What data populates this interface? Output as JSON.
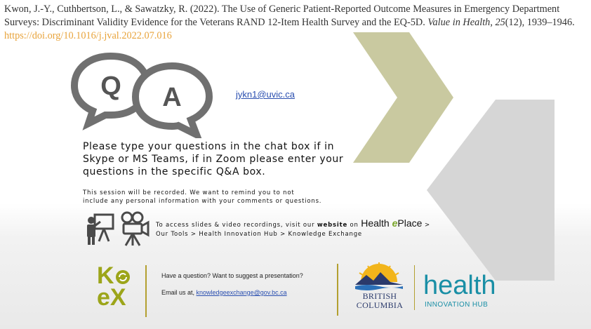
{
  "citation": {
    "text": "Kwon, J.-Y., Cuthbertson, L., & Sawatzky, R. (2022). The Use of Generic Patient-Reported Outcome Measures in Emergency Department Surveys: Discriminant Validity Evidence for the Veterans RAND 12-Item Health Survey and the EQ-5D.",
    "journal": "Value in Health",
    "volume": "25",
    "issue_pages": "(12), 1939–1946.",
    "doi": "https://doi.org/10.1016/j.jval.2022.07.016"
  },
  "qa": {
    "q_letter": "Q",
    "a_letter": "A",
    "email": "jykn1@uvic.ca"
  },
  "prompt": {
    "line1": "Please type your questions in the chat box if in",
    "line2": "Skype or MS Teams, if in Zoom please enter your",
    "line3": "questions in the specific  Q&A box."
  },
  "recording": {
    "line1": "This session will be recorded. We want to remind you to not",
    "line2": "include any personal information with your comments or questions."
  },
  "access": {
    "prefix": "To access slides & video recordings, visit our",
    "website": "website",
    "on": "on",
    "health": "Health ",
    "e": "e",
    "place": "Place",
    "arrow": " >",
    "path": "Our Tools > Health Innovation Hub > Knowledge Exchange"
  },
  "footer": {
    "kex_k": "K",
    "kex_e": "eX",
    "have_question": "Have a question? Want to suggest a presentation?",
    "email_label": "Email us at,",
    "email": "knowledgeexchange@gov.bc.ca",
    "bc_line1": "BRITISH",
    "bc_line2": "COLUMBIA",
    "hih_title": "health",
    "hih_subtitle": "INNOVATION HUB"
  },
  "colors": {
    "chevron_olive": "#c9c9a0",
    "chevron_grey": "#d6d6d6",
    "kex_green": "#9ca51a",
    "hih_teal": "#1a8fa6",
    "doi_orange": "#e8a33a"
  }
}
